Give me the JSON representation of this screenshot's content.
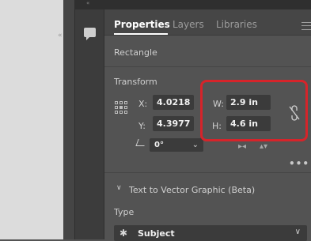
{
  "panel": {
    "tabs": [
      {
        "label": "Properties",
        "active": true
      },
      {
        "label": "Layers",
        "active": false
      },
      {
        "label": "Libraries",
        "active": false
      }
    ],
    "object_type": "Rectangle",
    "transform": {
      "title": "Transform",
      "x_label": "X:",
      "x_value": "4.0218 in",
      "y_label": "Y:",
      "y_value": "4.3977 in",
      "w_label": "W:",
      "w_value": "2.9 in",
      "h_label": "H:",
      "h_value": "4.6 in",
      "rotation_value": "0°",
      "constrain_proportions": false
    },
    "text_to_vector": {
      "title": "Text to Vector Graphic (Beta)",
      "type_label": "Type",
      "type_value": "Subject"
    }
  },
  "colors": {
    "highlight": "#d6242a",
    "panel_bg": "#535353",
    "field_bg": "#3b3b3b",
    "active_tab": "#ffffff"
  },
  "icons": [
    "comment-icon",
    "reference-point-icon",
    "constrain-proportions-icon",
    "rotate-icon",
    "flip-horizontal-icon",
    "flip-vertical-icon",
    "more-options-icon",
    "chevron-down-icon",
    "subject-icon",
    "panel-menu-icon"
  ]
}
